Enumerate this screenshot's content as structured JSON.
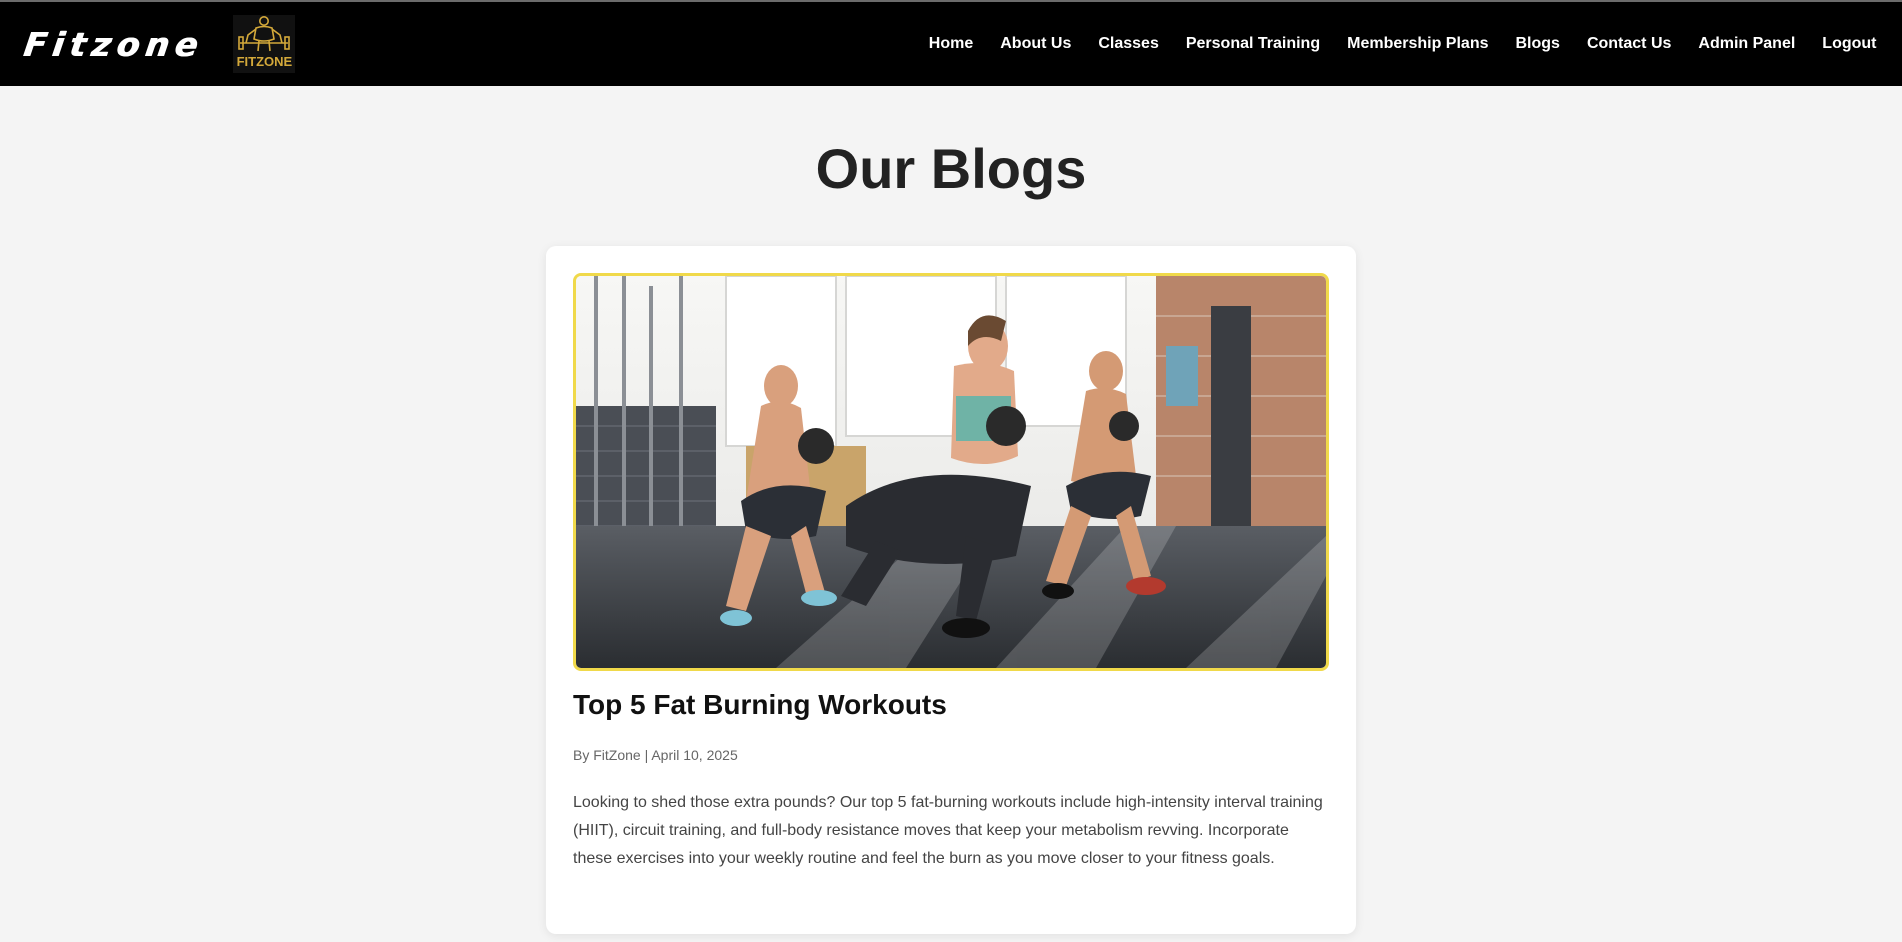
{
  "brand": {
    "wordmark": "Fitzone",
    "logo_text": "FITZONE"
  },
  "nav": {
    "items": [
      {
        "label": "Home"
      },
      {
        "label": "About Us"
      },
      {
        "label": "Classes"
      },
      {
        "label": "Personal Training"
      },
      {
        "label": "Membership Plans"
      },
      {
        "label": "Blogs"
      },
      {
        "label": "Contact Us"
      },
      {
        "label": "Admin Panel"
      },
      {
        "label": "Logout"
      }
    ]
  },
  "page": {
    "title": "Our Blogs"
  },
  "post": {
    "title": "Top 5 Fat Burning Workouts",
    "meta": "By FitZone | April 10, 2025",
    "excerpt": "Looking to shed those extra pounds? Our top 5 fat-burning workouts include high-intensity interval training (HIIT), circuit training, and full-body resistance moves that keep your metabolism revving. Incorporate these exercises into your weekly routine and feel the burn as you move closer to your fitness goals."
  },
  "colors": {
    "header_bg": "#000000",
    "page_bg": "#f4f4f4",
    "accent_border": "#f0d94a",
    "logo_gold": "#d4a93a"
  },
  "icons": {
    "logo": "bodybuilder-barbell-icon"
  }
}
